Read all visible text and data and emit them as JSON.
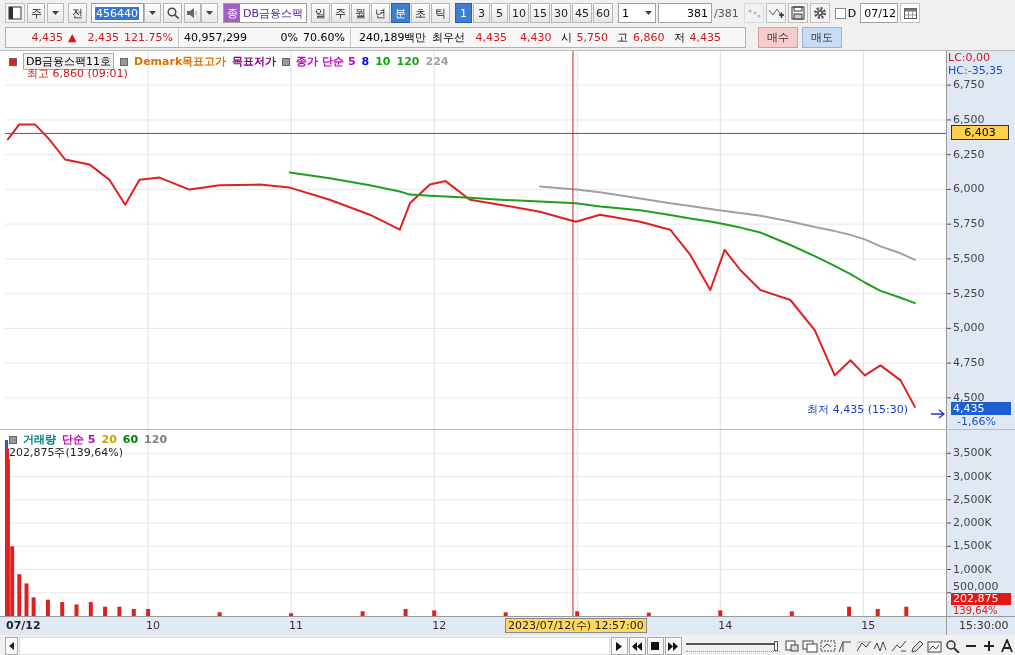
{
  "toolbar": {
    "market": "주",
    "prev_button": "전",
    "code": "456440",
    "name_badge": "종",
    "name": "DB금융스팩",
    "periods": [
      {
        "label": "일",
        "selected": false
      },
      {
        "label": "주",
        "selected": false
      },
      {
        "label": "월",
        "selected": false
      },
      {
        "label": "년",
        "selected": false
      },
      {
        "label": "분",
        "selected": true
      },
      {
        "label": "초",
        "selected": false
      },
      {
        "label": "틱",
        "selected": false
      }
    ],
    "intervals": [
      {
        "label": "1",
        "selected": true
      },
      {
        "label": "3",
        "selected": false
      },
      {
        "label": "5",
        "selected": false
      },
      {
        "label": "10",
        "selected": false
      },
      {
        "label": "15",
        "selected": false
      },
      {
        "label": "30",
        "selected": false
      },
      {
        "label": "45",
        "selected": false
      },
      {
        "label": "60",
        "selected": false
      }
    ],
    "count_select": "1",
    "count": "381",
    "total": "/381",
    "d_checkbox": {
      "label": "D",
      "checked": false
    },
    "date": "07/12"
  },
  "quote": {
    "price": "4,435",
    "arrow": "▲",
    "change": "2,435",
    "change_rate": "121.75%",
    "volume": "40,957,299",
    "field_4": "0%",
    "field_5": "70.60%",
    "amount": "240,189백만",
    "best_label": "최우선",
    "best_ask": "4,435",
    "best_bid": "4,430",
    "open_label": "시",
    "open": "5,750",
    "high_label": "고",
    "high": "6,860",
    "low_label": "저",
    "low": "4,435",
    "buy": "매수",
    "sell": "매도"
  },
  "price_panel": {
    "legend": [
      {
        "label": "Demark목표고가",
        "color": "#e07000"
      },
      {
        "label": "목표저가",
        "color": "#800080"
      },
      {
        "label": "종가 단순 5",
        "color": "#c000c0"
      },
      {
        "label": "8",
        "color": "#0000ff"
      },
      {
        "label": "10",
        "color": "#00b000"
      }
    ],
    "high_note": "최고 6,860 (09:01)",
    "low_note": "최저 4,435 (15:30)",
    "lc": "LC:0,00",
    "hc": "HC:-35,35",
    "cursor_value": "6,403",
    "last_price": "4,435",
    "last_change": "-1,66%",
    "chart_data": {
      "type": "line",
      "x": [
        9.02,
        9.1,
        9.21,
        9.31,
        9.42,
        9.59,
        9.73,
        9.84,
        9.94,
        10.08,
        10.29,
        10.5,
        10.78,
        10.99,
        11.27,
        11.55,
        11.76,
        11.83,
        11.97,
        12.08,
        12.25,
        12.46,
        12.74,
        12.99,
        13.16,
        13.44,
        13.65,
        13.79,
        13.93,
        14.03,
        14.14,
        14.28,
        14.49,
        14.66,
        14.8,
        14.91,
        15.01,
        15.12,
        15.26,
        15.36
      ],
      "series": [
        {
          "name": "DB금융스팩11호",
          "color": "#e02020",
          "values": [
            6360,
            6468,
            6468,
            6360,
            6215,
            6180,
            6070,
            5890,
            6070,
            6085,
            5999,
            6030,
            6035,
            6013,
            5926,
            5818,
            5710,
            5900,
            6035,
            6060,
            5926,
            5890,
            5840,
            5767,
            5818,
            5767,
            5710,
            5529,
            5276,
            5565,
            5420,
            5276,
            5204,
            4987,
            4662,
            4770,
            4662,
            4734,
            4626,
            4435
          ]
        },
        {
          "name": "120",
          "color": "#1ea01e",
          "values": [
            null,
            null,
            null,
            null,
            null,
            null,
            null,
            null,
            null,
            null,
            null,
            null,
            null,
            6121,
            6080,
            6030,
            5985,
            5963,
            5955,
            5950,
            5940,
            5926,
            5912,
            5900,
            5876,
            5850,
            5815,
            5790,
            5770,
            5750,
            5725,
            5690,
            5600,
            5520,
            5450,
            5390,
            5330,
            5270,
            5220,
            5182
          ]
        },
        {
          "name": "224",
          "color": "#a0a0a0",
          "values": [
            null,
            null,
            null,
            null,
            null,
            null,
            null,
            null,
            null,
            null,
            null,
            null,
            null,
            null,
            null,
            null,
            null,
            null,
            null,
            null,
            null,
            null,
            6020,
            6000,
            5980,
            5935,
            5900,
            5880,
            5860,
            5845,
            5830,
            5810,
            5770,
            5730,
            5700,
            5673,
            5640,
            5590,
            5540,
            5493
          ]
        }
      ],
      "xlim": [
        9,
        16.06
      ],
      "ylim": [
        4276,
        6996
      ],
      "grid": true,
      "ref_lines": [
        {
          "axis": "x",
          "value": 12.97,
          "color": "#d02020"
        },
        {
          "axis": "y",
          "value": 6403,
          "color": "#c03030"
        }
      ],
      "yticks": [
        {
          "value": 4500,
          "label": "4,500"
        },
        {
          "value": 4750,
          "label": "4,750"
        },
        {
          "value": 5000,
          "label": "5,000"
        },
        {
          "value": 5250,
          "label": "5,250"
        },
        {
          "value": 5500,
          "label": "5,500"
        },
        {
          "value": 5750,
          "label": "5,750"
        },
        {
          "value": 6000,
          "label": "6,000"
        },
        {
          "value": 6250,
          "label": "6,250"
        },
        {
          "value": 6500,
          "label": "6,500"
        },
        {
          "value": 6750,
          "label": "6,750"
        }
      ]
    }
  },
  "volume_panel": {
    "legend": [
      {
        "label": "단순 5",
        "color": "#c000c0"
      },
      {
        "label": "20",
        "color": "#d0a000"
      },
      {
        "label": "60",
        "color": "#008000"
      },
      {
        "label": "120",
        "color": "#808080"
      }
    ],
    "note": "202,875주(139,64%)",
    "last_volume": "202,875",
    "last_ratio": "139,64%",
    "chart_data": {
      "type": "bar",
      "x": [
        9.02,
        9.05,
        9.1,
        9.15,
        9.2,
        9.3,
        9.4,
        9.5,
        9.6,
        9.7,
        9.8,
        9.9,
        10,
        10.5,
        11,
        11.5,
        11.8,
        12,
        12.5,
        13,
        13.5,
        14,
        14.5,
        14.9,
        15.1,
        15.3
      ],
      "series": [
        {
          "name": "거래량",
          "color": "#e02020",
          "values": [
            3600000,
            1500000,
            900000,
            700000,
            400000,
            350000,
            300000,
            250000,
            300000,
            200000,
            200000,
            150000,
            150000,
            80000,
            60000,
            100000,
            150000,
            120000,
            80000,
            100000,
            70000,
            120000,
            100000,
            200000,
            150000,
            200000
          ]
        }
      ],
      "xlim": [
        9,
        16.06
      ],
      "ylim": [
        0,
        4000000
      ],
      "grid": true,
      "ref_lines": [
        {
          "axis": "x",
          "value": 12.97,
          "color": "#d02020"
        }
      ],
      "xticks": [
        {
          "value": 10,
          "label": "10"
        },
        {
          "value": 11,
          "label": "11"
        },
        {
          "value": 12,
          "label": "12"
        },
        {
          "value": 14,
          "label": "14"
        },
        {
          "value": 15,
          "label": "15"
        }
      ],
      "yticks": [
        {
          "value": 500000,
          "label": "500,000"
        },
        {
          "value": 1000000,
          "label": "1,000K"
        },
        {
          "value": 1500000,
          "label": "1,500K"
        },
        {
          "value": 2000000,
          "label": "2,000K"
        },
        {
          "value": 2500000,
          "label": "2,500K"
        },
        {
          "value": 3000000,
          "label": "3,000K"
        },
        {
          "value": 3500000,
          "label": "3,500K"
        }
      ]
    }
  },
  "x_axis": {
    "start_label": "07/12",
    "cursor_time": "2023/07/12(수) 12:57:00",
    "end_time": "15:30:00"
  },
  "bottom_bar": {
    "zoom": {
      "level": 0.97
    }
  }
}
